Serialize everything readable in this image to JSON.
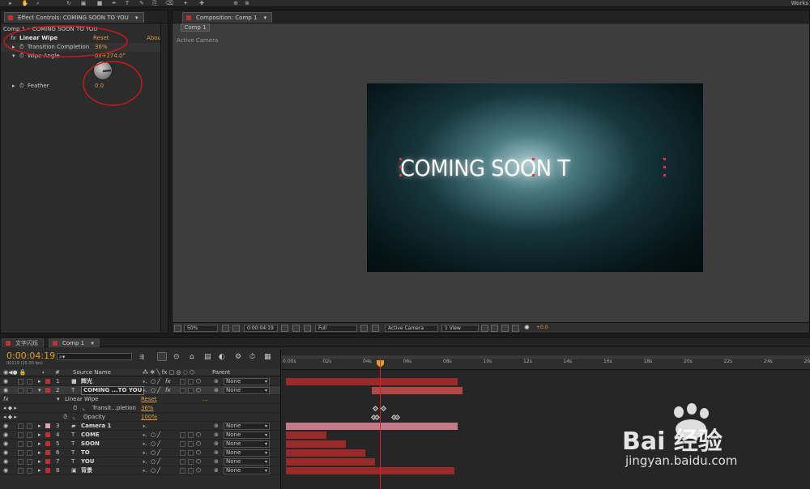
{
  "toolbar": {
    "workspace": "Works"
  },
  "effect_controls": {
    "tab_label": "Effect Controls: COMING SOON TO YOU",
    "breadcrumb": "Comp 1 • COMING SOON TO YOU",
    "effect_name": "Linear Wipe",
    "reset_label": "Reset",
    "about_label": "Abou",
    "transition_completion_label": "Transition Completion",
    "transition_completion_value": "36%",
    "wipe_angle_label": "Wipe Angle",
    "wipe_angle_value": "0x+274.0°",
    "feather_label": "Feather",
    "feather_value": "0.0"
  },
  "composition": {
    "tab_label": "Composition: Comp 1",
    "subtab_label": "Comp 1",
    "camera_label": "Active Camera",
    "comp_text": "COMING SOON T",
    "footer": {
      "zoom": "50%",
      "timecode": "0:00:04:19",
      "resolution": "Full",
      "camera": "Active Camera",
      "views": "1 View",
      "exposure": "+0.0"
    }
  },
  "timeline": {
    "tabs": [
      "文字闪烁",
      "Comp 1"
    ],
    "timecode": "0:00:04:19",
    "fps": "00119 (25.00 fps)",
    "headers": {
      "num": "#",
      "source": "Source Name",
      "parent": "Parent"
    },
    "ruler": [
      "0:00s",
      "02s",
      "04s",
      "06s",
      "08s",
      "10s",
      "12s",
      "14s",
      "16s",
      "18s",
      "20s",
      "22s",
      "24s",
      "26"
    ],
    "layers": [
      {
        "num": "1",
        "name": "辉光",
        "parent": "None",
        "color": "#c03030"
      },
      {
        "num": "2",
        "name": "COMING ...TO YOU",
        "parent": "None",
        "color": "#c03030"
      },
      {
        "num": "3",
        "name": "Camera 1",
        "parent": "None",
        "color": "#e0a0b0"
      },
      {
        "num": "4",
        "name": "COME",
        "parent": "None",
        "color": "#c03030"
      },
      {
        "num": "5",
        "name": "SOON",
        "parent": "None",
        "color": "#c03030"
      },
      {
        "num": "6",
        "name": "TO",
        "parent": "None",
        "color": "#c03030"
      },
      {
        "num": "7",
        "name": "YOU",
        "parent": "None",
        "color": "#c03030"
      },
      {
        "num": "8",
        "name": "背景",
        "parent": "None",
        "color": "#c03030"
      }
    ],
    "sub": {
      "effect": "Linear Wipe",
      "reset": "Reset",
      "dots": "...",
      "transition": "Transit...pletion",
      "transition_value": "36%",
      "opacity": "Opacity",
      "opacity_value": "100%"
    }
  },
  "watermark": {
    "brand": "Bai  经验",
    "url": "jingyan.baidu.com"
  },
  "colors": {
    "accent": "#d8a040",
    "playhead": "#e02020",
    "layer_bar": "#9a2a2a",
    "camera_bar": "#c47a8a"
  }
}
